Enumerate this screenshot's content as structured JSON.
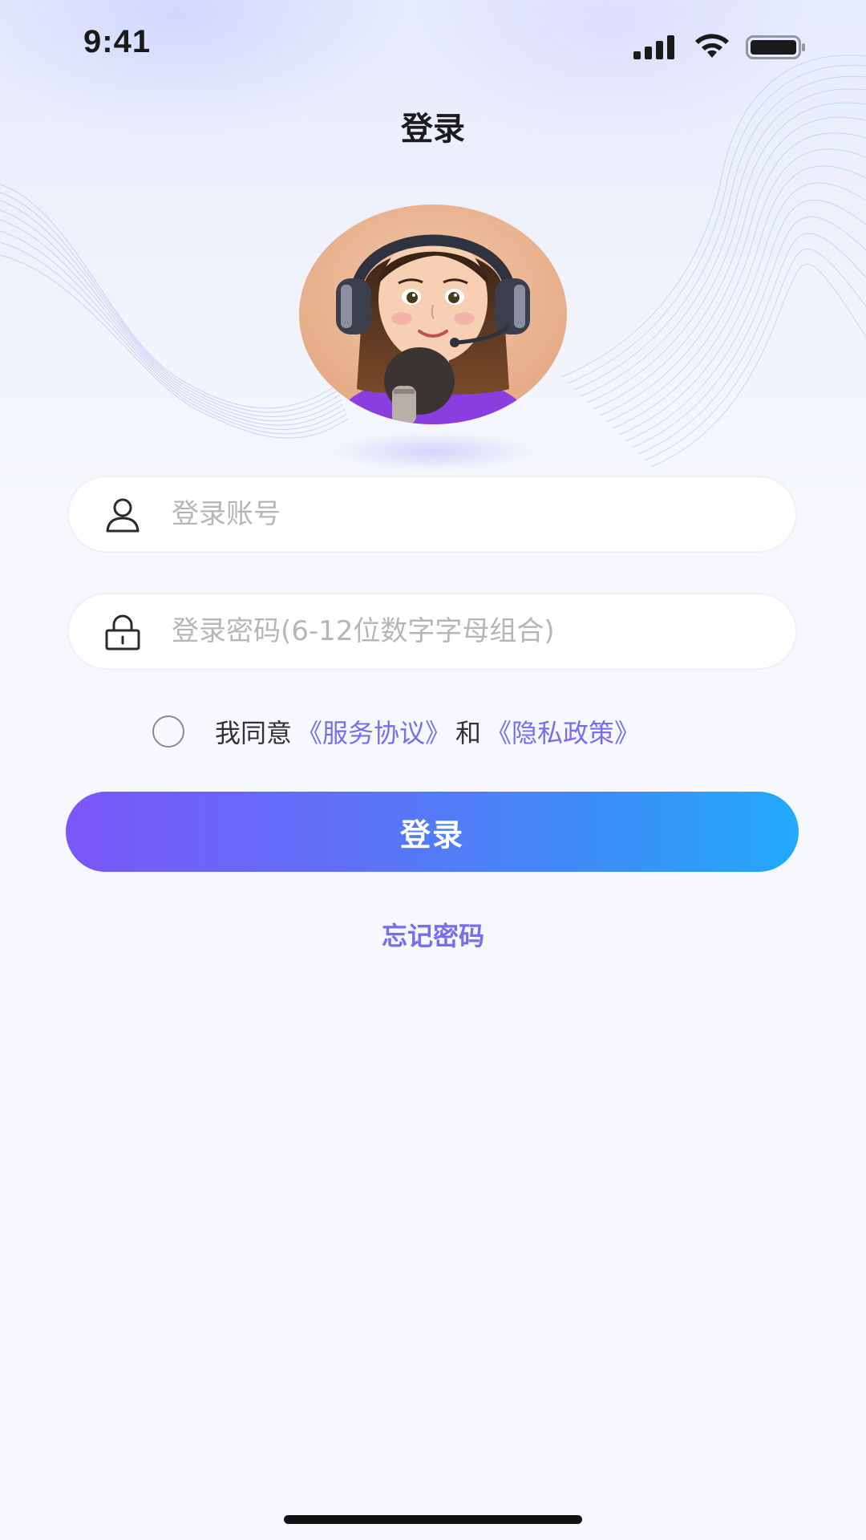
{
  "status_bar": {
    "time": "9:41"
  },
  "header": {
    "title": "登录"
  },
  "avatar": {
    "icon": "customer-service-avatar"
  },
  "form": {
    "account_placeholder": "登录账号",
    "account_value": "",
    "account_icon": "user-icon",
    "password_placeholder": "登录密码(6-12位数字字母组合)",
    "password_value": "",
    "password_icon": "lock-icon"
  },
  "agreement": {
    "checked": false,
    "prefix": "我同意",
    "service_link": "《服务协议》",
    "conjunction": "和",
    "privacy_link": "《隐私政策》"
  },
  "actions": {
    "login_label": "登录",
    "forgot_label": "忘记密码"
  },
  "colors": {
    "accent": "#7a6cf0",
    "button_gradient_start": "#7a57f7",
    "button_gradient_end": "#22aafb",
    "background": "#f6f8fd"
  }
}
